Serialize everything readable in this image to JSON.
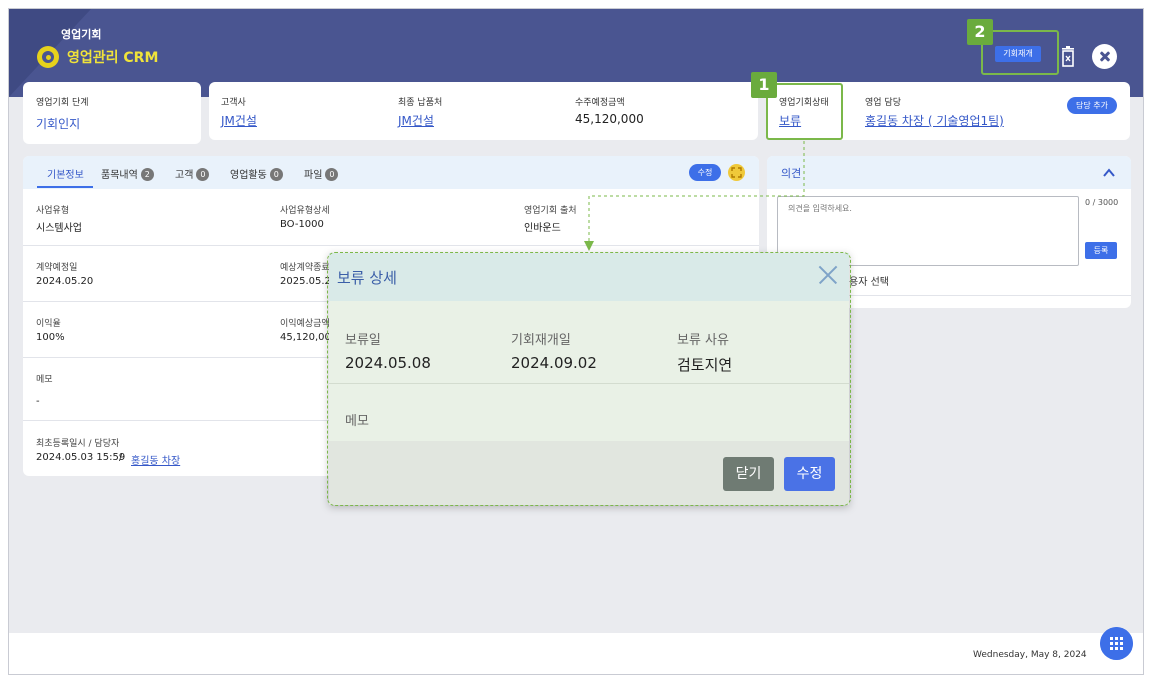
{
  "header": {
    "module": "영업기회",
    "title": "영업관리 CRM",
    "reopen_button": "기회재개"
  },
  "summary": {
    "stage": {
      "label": "영업기회 단계",
      "value": "기회인지"
    },
    "customer": {
      "label": "고객사",
      "value": "JM건설"
    },
    "final_delivery": {
      "label": "최종 납품처",
      "value": "JM건설"
    },
    "expected_amount": {
      "label": "수주예정금액",
      "value": "45,120,000"
    },
    "status": {
      "label": "영업기회상태",
      "value": "보류"
    },
    "owner": {
      "label": "영업 담당",
      "value": "홍길동 차장 ( 기술영업1팀)",
      "add_button": "담당 추가"
    }
  },
  "tabs": {
    "items": [
      {
        "label": "기본정보"
      },
      {
        "label": "품목내역",
        "count": "2"
      },
      {
        "label": "고객",
        "count": "0"
      },
      {
        "label": "영업활동",
        "count": "0"
      },
      {
        "label": "파일",
        "count": "0"
      }
    ],
    "edit_button": "수정"
  },
  "basic": {
    "biz_type": {
      "label": "사업유형",
      "value": "시스템사업"
    },
    "biz_type_detail": {
      "label": "사업유형상세",
      "value": "BO-1000"
    },
    "source": {
      "label": "영업기회 출처",
      "value": "인바운드"
    },
    "contract_date": {
      "label": "계약예정일",
      "value": "2024.05.20"
    },
    "expected_contract": {
      "label": "예상계약종료",
      "value": "2025.05.20"
    },
    "margin": {
      "label": "이익율",
      "value": "100%"
    },
    "expected_profit": {
      "label": "이익예상금액",
      "value": "45,120,000"
    },
    "memo": {
      "label": "메모",
      "value": "-"
    },
    "registered": {
      "label": "최초등록일시 / 담당자",
      "datetime": "2024.05.03 15:59",
      "separator": "/",
      "user": "홍길동 차장"
    }
  },
  "opinion": {
    "title": "의견",
    "placeholder": "의견을 입력하세요.",
    "counter": "0 / 3000",
    "submit": "등록",
    "select_user": "용자 선택"
  },
  "modal": {
    "title": "보류 상세",
    "hold_date": {
      "label": "보류일",
      "value": "2024.05.08"
    },
    "reopen_date": {
      "label": "기회재개일",
      "value": "2024.09.02"
    },
    "reason": {
      "label": "보류 사유",
      "value": "검토지연"
    },
    "memo_label": "메모",
    "close_button": "닫기",
    "edit_button": "수정"
  },
  "footer": {
    "date": "Wednesday, May 8, 2024"
  },
  "callouts": {
    "one": "1",
    "two": "2"
  },
  "colors": {
    "header": "#4a5591",
    "accent": "#3d6fe8",
    "logo": "#e6d21c",
    "callout": "#6aab3d"
  }
}
